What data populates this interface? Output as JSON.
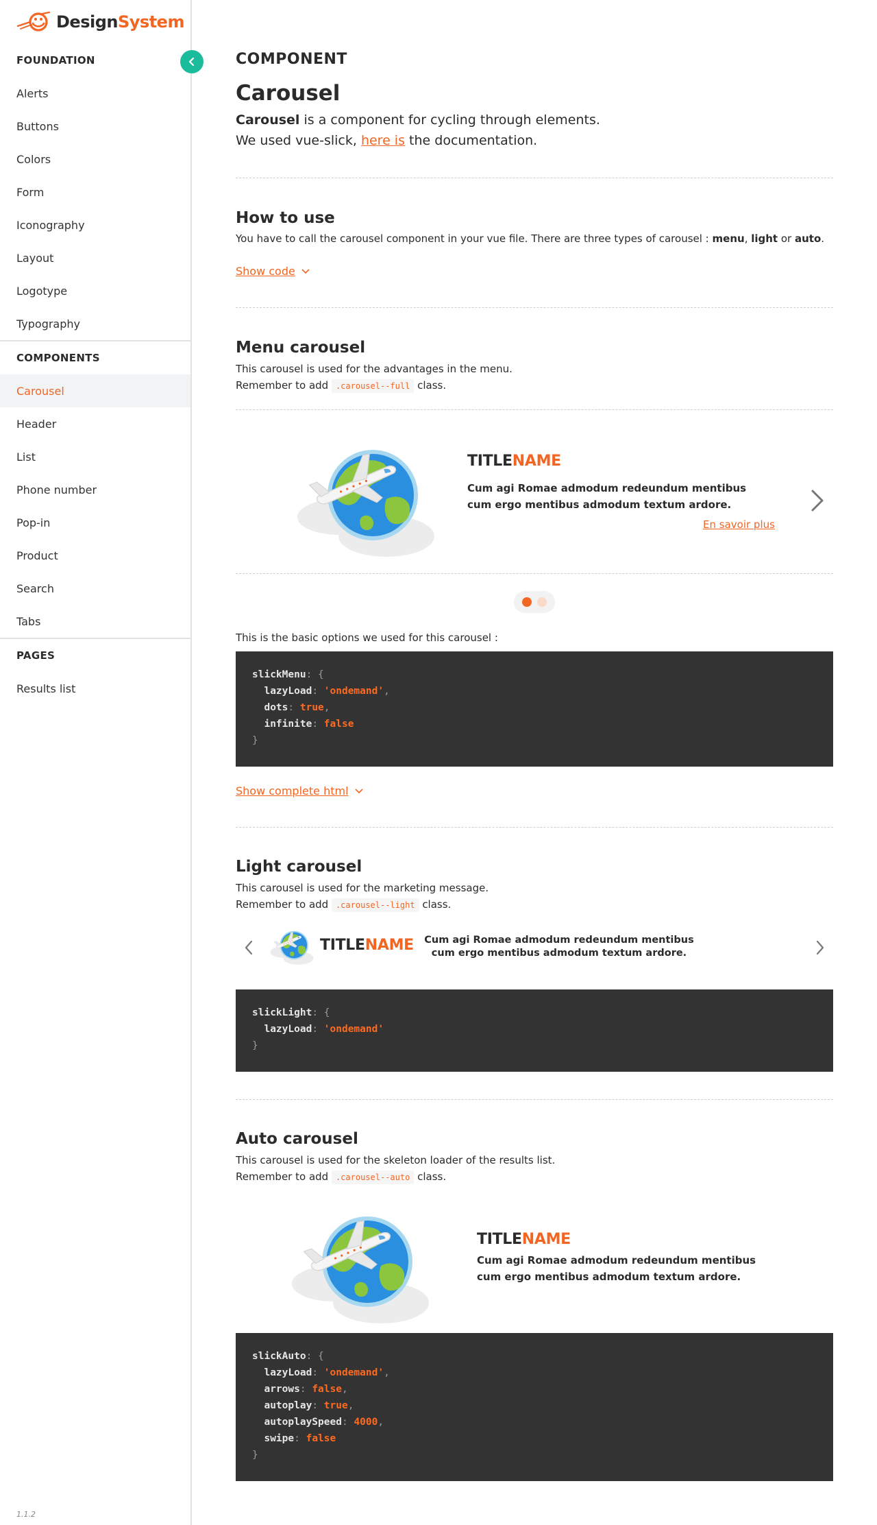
{
  "brand": {
    "part1": "Design",
    "part2": "System",
    "color": "#f26522"
  },
  "sidebar": {
    "foundation_heading": "FOUNDATION",
    "foundation_items": [
      "Alerts",
      "Buttons",
      "Colors",
      "Form",
      "Iconography",
      "Layout",
      "Logotype",
      "Typography"
    ],
    "components_heading": "COMPONENTS",
    "components_items": [
      "Carousel",
      "Header",
      "List",
      "Phone number",
      "Pop-in",
      "Product",
      "Search",
      "Tabs"
    ],
    "active_item": "Carousel",
    "pages_heading": "PAGES",
    "pages_items": [
      "Results list"
    ],
    "version": "1.1.2",
    "collapse_icon": "chevron-left-icon",
    "collapse_color": "#1abc9c"
  },
  "page": {
    "kicker": "COMPONENT",
    "title": "Carousel",
    "intro_bold": "Carousel",
    "intro_line1_rest": " is a component for cycling through elements.",
    "intro_line2_start": "We used vue-slick, ",
    "intro_link": "here is",
    "intro_line2_end": " the documentation."
  },
  "how_to_use": {
    "title": "How to use",
    "text_start": "You have to call the carousel component in your vue file. There are three types of carousel : ",
    "type1": "menu",
    "sep1": ", ",
    "type2": "light",
    "sep2": " or ",
    "type3": "auto",
    "text_end": ".",
    "show_code": "Show code"
  },
  "menu_carousel": {
    "title": "Menu carousel",
    "desc": "This carousel is used for the advantages in the menu.",
    "remember": "Remember to add ",
    "class_name": ".carousel--full",
    "class_suffix": " class.",
    "slide_title1": "TITLE",
    "slide_title2": "NAME",
    "slide_text": "Cum agi Romae admodum redeundum mentibus cum ergo mentibus admodum textum ardore.",
    "slide_link": "En savoir plus",
    "options_label": "This is the basic options we used for this carousel :",
    "show_html": "Show complete html",
    "code": {
      "obj": "slickMenu",
      "k1": "lazyLoad",
      "v1": "'ondemand'",
      "k2": "dots",
      "v2": "true",
      "k3": "infinite",
      "v3": "false"
    }
  },
  "light_carousel": {
    "title": "Light carousel",
    "desc": "This carousel is used for the marketing message.",
    "remember": "Remember to add ",
    "class_name": ".carousel--light",
    "class_suffix": " class.",
    "slide_title1": "TITLE",
    "slide_title2": "NAME",
    "slide_text": "Cum agi Romae admodum redeundum mentibus cum ergo mentibus admodum textum ardore.",
    "code": {
      "obj": "slickLight",
      "k1": "lazyLoad",
      "v1": "'ondemand'"
    }
  },
  "auto_carousel": {
    "title": "Auto carousel",
    "desc": "This carousel is used for the skeleton loader of the results list.",
    "remember": "Remember to add ",
    "class_name": ".carousel--auto",
    "class_suffix": " class.",
    "slide_title1": "TITLE",
    "slide_title2": "NAME",
    "slide_text": "Cum agi Romae admodum redeundum mentibus cum ergo mentibus admodum textum ardore.",
    "code": {
      "obj": "slickAuto",
      "k1": "lazyLoad",
      "v1": "'ondemand'",
      "k2": "arrows",
      "v2": "false",
      "k3": "autoplay",
      "v3": "true",
      "k4": "autoplaySpeed",
      "v4": "4000",
      "k5": "swipe",
      "v5": "false"
    }
  },
  "colors": {
    "accent": "#f26522",
    "code_bg": "#333333",
    "teal": "#1abc9c"
  }
}
